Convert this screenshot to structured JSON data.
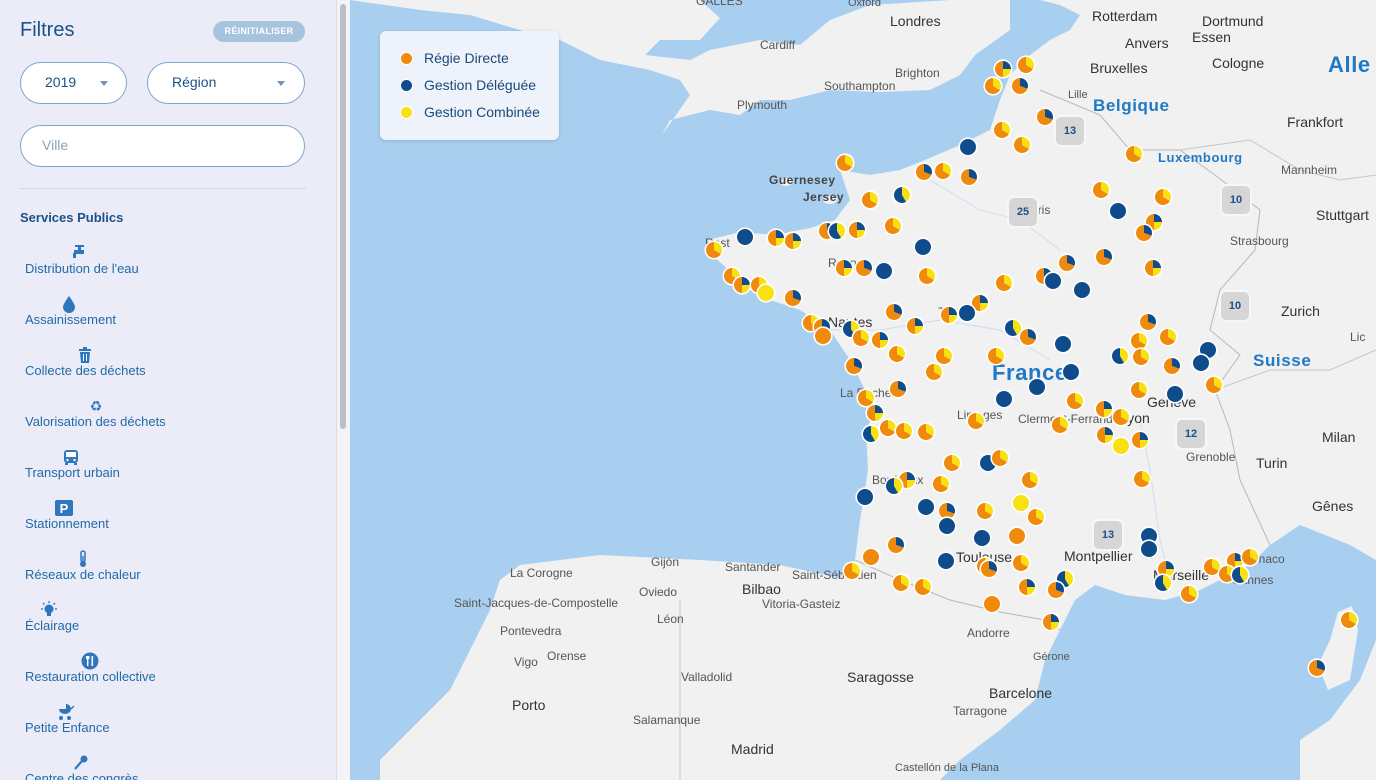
{
  "filters": {
    "title": "Filtres",
    "reset_label": "RÉINITIALISER",
    "year_select": "2019",
    "region_select": "Région",
    "city_placeholder": "Ville"
  },
  "services": {
    "title": "Services Publics",
    "items": [
      {
        "label": "Distribution de l'eau",
        "icon": "water-tap-icon"
      },
      {
        "label": "Assainissement",
        "icon": "water-drop-icon"
      },
      {
        "label": "Collecte des déchets",
        "icon": "trash-icon"
      },
      {
        "label": "Valorisation des déchets",
        "icon": "recycle-icon"
      },
      {
        "label": "Transport urbain",
        "icon": "bus-icon"
      },
      {
        "label": "Stationnement",
        "icon": "parking-icon"
      },
      {
        "label": "Réseaux de chaleur",
        "icon": "thermometer-icon"
      },
      {
        "label": "Éclairage",
        "icon": "lightbulb-icon"
      },
      {
        "label": "Restauration collective",
        "icon": "cutlery-icon"
      },
      {
        "label": "Petite Enfance",
        "icon": "stroller-icon"
      },
      {
        "label": "Centre des congrès",
        "icon": "microphone-icon"
      }
    ]
  },
  "legend": {
    "items": [
      {
        "label": "Régie Directe",
        "color": "#f08a0c"
      },
      {
        "label": "Gestion Déléguée",
        "color": "#0f4c8c"
      },
      {
        "label": "Gestion Combinée",
        "color": "#f8e011"
      }
    ]
  },
  "clusters": [
    "13",
    "25",
    "10",
    "10",
    "12",
    "13"
  ],
  "map_labels": {
    "countries": [
      "Belgique",
      "Luxembourg",
      "Suisse",
      "Alle",
      "France"
    ],
    "cities": [
      "GALLES",
      "Oxford",
      "Londres",
      "Rotterdam",
      "Dortmund",
      "Essen",
      "Anvers",
      "Cologne",
      "Cardiff",
      "Bruxelles",
      "Brighton",
      "Southampton",
      "Plymouth",
      "Lille",
      "Frankfort",
      "Guernesey",
      "Jersey",
      "Mannheim",
      "Stuttgart",
      "Strasbourg",
      "Zurich",
      "Nantes",
      "Tours",
      "La Rochelle",
      "Limoges",
      "Clermont-Ferrand",
      "Lyon",
      "Genève",
      "Grenoble",
      "Milan",
      "Turin",
      "Gênes",
      "Bordeaux",
      "Toulouse",
      "Montpellier",
      "Marseille",
      "Monaco",
      "Cannes",
      "Andorre",
      "Gijón",
      "La Corogne",
      "Santander",
      "Oviedo",
      "Bilbao",
      "Saint-Sébastien",
      "Vitoria-Gasteiz",
      "Saint-Jacques-de-Compostelle",
      "Pontevedra",
      "Léon",
      "Orense",
      "Vigo",
      "Valladolid",
      "Saragosse",
      "Barcelone",
      "Gérone",
      "Porto",
      "Tarragone",
      "Salamanque",
      "Madrid",
      "Castellón de la Plana",
      "Lic",
      "Rest",
      "Renne",
      "Paris"
    ]
  }
}
